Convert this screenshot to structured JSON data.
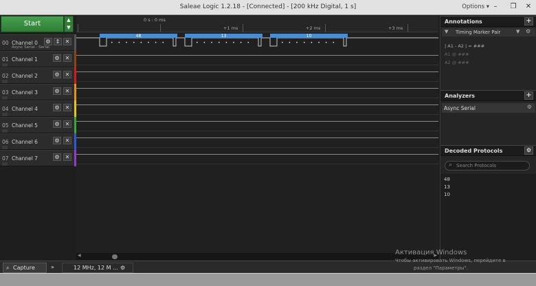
{
  "window": {
    "title": "Saleae Logic 1.2.18 - [Connected] - [200 kHz Digital, 1 s]",
    "options_label": "Options ▾",
    "minimize": "–",
    "restore": "❐",
    "close": "✕"
  },
  "toolbar": {
    "start_label": "Start",
    "up_glyph": "▲",
    "down_glyph": "▼"
  },
  "channels": [
    {
      "num": "00",
      "name": "Channel 0",
      "sub": "Async Serial - Serial",
      "color": "#555555"
    },
    {
      "num": "01",
      "name": "Channel 1",
      "color": "#8b4513"
    },
    {
      "num": "02",
      "name": "Channel 2",
      "color": "#d21d1d"
    },
    {
      "num": "03",
      "name": "Channel 3",
      "color": "#e8901c"
    },
    {
      "num": "04",
      "name": "Channel 4",
      "color": "#e6c619"
    },
    {
      "num": "05",
      "name": "Channel 5",
      "color": "#3aa635"
    },
    {
      "num": "06",
      "name": "Channel 6",
      "color": "#2d58d8"
    },
    {
      "num": "07",
      "name": "Channel 7",
      "color": "#8f3fc6"
    }
  ],
  "icons": {
    "gear": "⚙",
    "close": "✕",
    "edge": "↕",
    "search": "⌕",
    "filter": "▼"
  },
  "ruler": {
    "origin": "0 s : 0 ms",
    "m1": "+1 ms",
    "m2": "+2 ms",
    "m3": "+3 ms"
  },
  "decoded_frames": [
    {
      "label": "48",
      "bits": "• • • • • • • •"
    },
    {
      "label": "13",
      "bits": "• • • • • • • •"
    },
    {
      "label": "10",
      "bits": "• • • • • • • •"
    }
  ],
  "annotations": {
    "header": "Annotations",
    "add": "+",
    "marker_pair": "Timing Marker Pair",
    "a1a2": "| A1 - A2 | = ###",
    "a1": "A1  @  ###",
    "a2": "A2  @  ###"
  },
  "analyzers": {
    "header": "Analyzers",
    "add": "+",
    "items": [
      "Async Serial"
    ]
  },
  "decoded_protocols": {
    "header": "Decoded Protocols",
    "search_placeholder": "Search Protocols",
    "items": [
      "48",
      "13",
      "10"
    ]
  },
  "bottom": {
    "capture_tab": "Capture",
    "expand": "»",
    "session_tab": "12 MHz, 12 M ..."
  },
  "watermark": {
    "title": "Активация Windows",
    "line1": "Чтобы активировать Windows, перейдите в",
    "line2": "раздел \"Параметры\"."
  }
}
